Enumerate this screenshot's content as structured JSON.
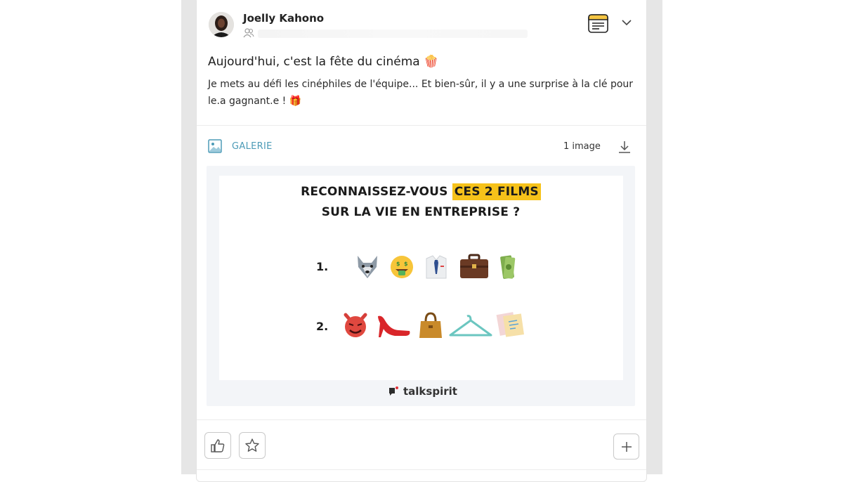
{
  "post": {
    "author": "Joelly Kahono",
    "title": "Aujourd'hui, c'est la fête du cinéma 🍿",
    "body": "Je mets au défi les cinéphiles de l'équipe... Et bien-sûr, il y a une surprise à la clé pour le.a gagnant.e ! 🎁"
  },
  "gallery": {
    "label": "GALERIE",
    "count": "1 image"
  },
  "quiz_image": {
    "line1_prefix": "RECONNAISSEZ-VOUS ",
    "line1_highlight": "CES 2 FILMS",
    "line2": "SUR LA VIE EN ENTREPRISE ?",
    "item1_number": "1.",
    "item2_number": "2.",
    "brand": "talkspirit"
  },
  "icons": {
    "audience": "group-icon",
    "post_type": "article-icon",
    "menu": "chevron-down-icon",
    "gallery": "image-icon",
    "download": "download-icon",
    "like": "thumbs-up-icon",
    "favorite": "star-icon",
    "add": "plus-icon"
  },
  "colors": {
    "accent": "#4d9bb7",
    "highlight": "#f6c21a",
    "post_type_icon": "#f5c542"
  }
}
